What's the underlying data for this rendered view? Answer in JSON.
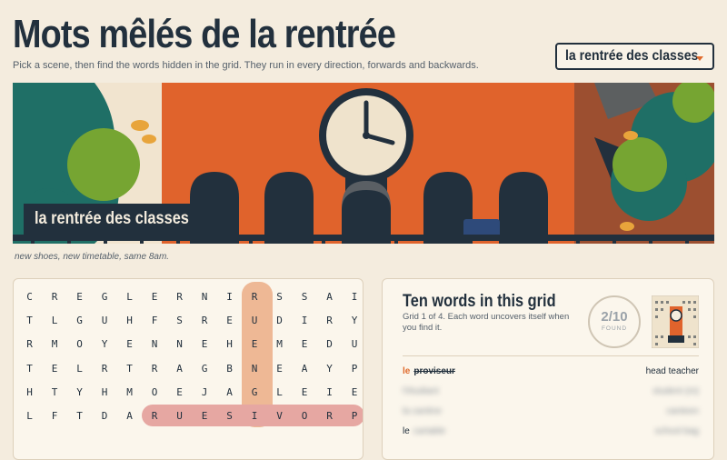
{
  "header": {
    "title": "Mots mêlés de la rentrée",
    "subtitle": "Pick a scene, then find the words hidden in the grid. They run in every direction, forwards and backwards."
  },
  "scene_select": {
    "value": "la rentrée des classes"
  },
  "hero": {
    "caption": "la rentrée des classes",
    "note": "new shoes, new timetable, same 8am."
  },
  "grid": {
    "rows": [
      [
        "C",
        "R",
        "E",
        "G",
        "L",
        "E",
        "R",
        "N",
        "I",
        "R",
        "S",
        "S",
        "A",
        "I"
      ],
      [
        "T",
        "L",
        "G",
        "U",
        "H",
        "F",
        "S",
        "R",
        "E",
        "U",
        "D",
        "I",
        "R",
        "Y"
      ],
      [
        "R",
        "M",
        "O",
        "Y",
        "E",
        "N",
        "N",
        "E",
        "H",
        "E",
        "M",
        "E",
        "D",
        "U"
      ],
      [
        "T",
        "E",
        "L",
        "R",
        "T",
        "R",
        "A",
        "G",
        "B",
        "N",
        "E",
        "A",
        "Y",
        "P"
      ],
      [
        "H",
        "T",
        "Y",
        "H",
        "M",
        "O",
        "E",
        "J",
        "A",
        "G",
        "L",
        "E",
        "I",
        "E"
      ],
      [
        "L",
        "F",
        "T",
        "D",
        "A",
        "R",
        "U",
        "E",
        "S",
        "I",
        "V",
        "O",
        "R",
        "P"
      ]
    ]
  },
  "words_panel": {
    "title": "Ten words in this grid",
    "subtitle": "Grid 1 of 4. Each word uncovers itself when you find it.",
    "found_count": "2/10",
    "found_label": "FOUND",
    "words": [
      {
        "article": "le",
        "word": "proviseur",
        "hint": "head teacher",
        "found": true
      },
      {
        "article": "",
        "word": "l'étudiant",
        "hint": "student (m)",
        "found": false
      },
      {
        "article": "",
        "word": "la cantine",
        "hint": "canteen",
        "found": false
      },
      {
        "article": "le",
        "word": "cartable",
        "hint": "school bag",
        "found": false
      }
    ]
  },
  "colors": {
    "ink": "#22303d",
    "accent": "#e06a2c",
    "background": "#f4ecde",
    "highlight_vertical": "#eeb895",
    "highlight_horizontal": "#e6a7a2"
  }
}
